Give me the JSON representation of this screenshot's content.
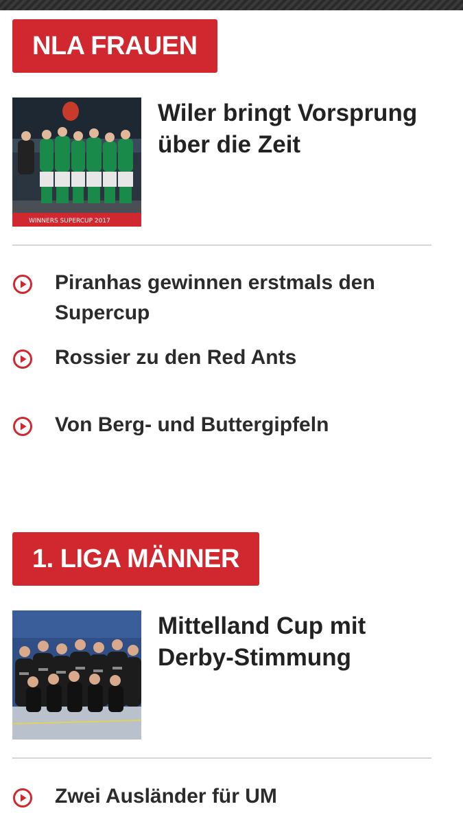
{
  "colors": {
    "accent": "#d0282e",
    "text": "#222222",
    "divider": "#d6d6d6"
  },
  "sections": [
    {
      "header": "NLA FRAUEN",
      "teaser": {
        "title": "Wiler bringt Vorsprung über die Zeit",
        "image_caption": "WINNERS SUPERCUP 2017"
      },
      "links": [
        {
          "icon": "play-circle-icon",
          "label": "Piranhas gewinnen erstmals den Supercup"
        },
        {
          "icon": "play-circle-icon",
          "label": "Rossier zu den Red Ants"
        },
        {
          "icon": "play-circle-icon",
          "label": "Von Berg- und Buttergipfeln"
        }
      ]
    },
    {
      "header": "1. LIGA MÄNNER",
      "teaser": {
        "title": "Mittelland Cup mit Derby-Stimmung"
      },
      "links": [
        {
          "icon": "play-circle-icon",
          "label": "Zwei Ausländer für UM"
        }
      ]
    }
  ]
}
